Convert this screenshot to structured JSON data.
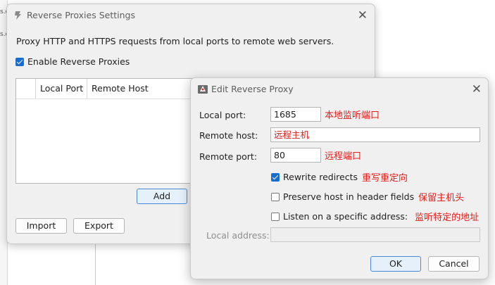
{
  "background": {
    "left_fragment_1": "s.c",
    "left_fragment_2": "s.c"
  },
  "settings_window": {
    "title": "Reverse Proxies Settings",
    "description": "Proxy HTTP and HTTPS requests from local ports to remote web servers.",
    "enable_label": "Enable Reverse Proxies",
    "enable_checked": true,
    "columns": [
      "Local Port",
      "Remote Host"
    ],
    "add_label": "Add",
    "import_label": "Import",
    "export_label": "Export"
  },
  "edit_dialog": {
    "title": "Edit Reverse Proxy",
    "local_port_label": "Local port:",
    "local_port_value": "1685",
    "local_port_note": "本地监听端口",
    "remote_host_label": "Remote host:",
    "remote_host_value": "远程主机",
    "remote_port_label": "Remote port:",
    "remote_port_value": "80",
    "remote_port_note": "远程端口",
    "rewrite_label": "Rewrite redirects",
    "rewrite_checked": true,
    "rewrite_note": "重写重定向",
    "preserve_label": "Preserve host in header fields",
    "preserve_checked": false,
    "preserve_note": "保留主机头",
    "listen_label": "Listen on a specific address:",
    "listen_checked": false,
    "listen_note": "监听特定的地址",
    "local_address_label": "Local address:",
    "local_address_value": "",
    "ok_label": "OK",
    "cancel_label": "Cancel"
  },
  "colors": {
    "accent": "#1a6dd0",
    "annotation": "#e0201c"
  }
}
